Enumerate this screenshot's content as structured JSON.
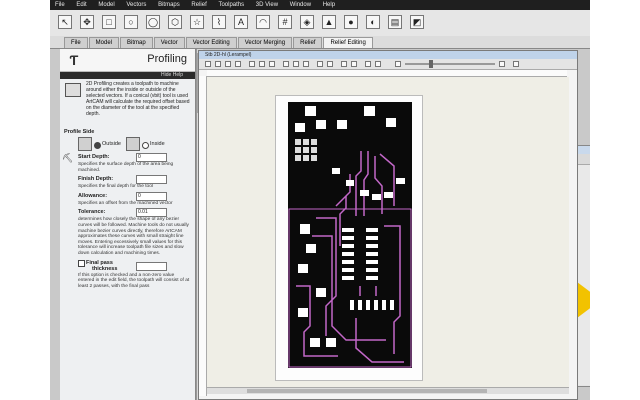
{
  "app": {
    "menu": [
      "File",
      "Edit",
      "Model",
      "Vectors",
      "Bitmaps",
      "Relief",
      "Toolpaths",
      "3D View",
      "Window",
      "Help"
    ]
  },
  "tabs": [
    {
      "label": "File",
      "active": false
    },
    {
      "label": "Model",
      "active": false
    },
    {
      "label": "Bitmap",
      "active": false
    },
    {
      "label": "Vector",
      "active": false
    },
    {
      "label": "Vector Editing",
      "active": false
    },
    {
      "label": "Vector Merging",
      "active": false
    },
    {
      "label": "Relief",
      "active": false
    },
    {
      "label": "Relief Editing",
      "active": true
    }
  ],
  "panel": {
    "title": "Profiling",
    "hide_help": "Hide Help",
    "description": "2D Profiling creates a toolpath to machine around either the inside or outside of the selected vectors. If a conical (vbit) tool is used ArtCAM will calculate the required offset based on the diameter of the tool at the specified depth.",
    "profile_side": {
      "title": "Profile Side",
      "outside": "Outside",
      "inside": "Inside",
      "selected": "outside"
    },
    "start_depth": {
      "label": "Start Depth:",
      "value": "0",
      "help": "Specifies the surface depth of the area being machined."
    },
    "finish_depth": {
      "label": "Finish Depth:",
      "value": "",
      "help": "Specifies the final depth for the tool"
    },
    "allowance": {
      "label": "Allowance:",
      "value": "0",
      "help": "Specifies an offset from the machined vector"
    },
    "tolerance": {
      "label": "Tolerance:",
      "value": "0.01",
      "help": "determines how closely the shape of any bezier curves will be followed. Machine tools do not usually machine bezier curves directly, therefore ArtCAM approximates these curves with small straight line moves. Entering excessively small values for this tolerance will increase toolpath file sizes and slow down calculation and machining times."
    },
    "final_pass": {
      "label": "Final pass",
      "label2": "thickness",
      "help": "If this option is checked and a non-zero value entered in the edit field, the toolpath will consist of at least 2 passes, with the final pass"
    }
  },
  "document": {
    "title": "Stb 2D-hl (Lerampel)"
  },
  "colors": {
    "trace": "#0a0a0a",
    "outline": "#c267c8",
    "background_window_accent": "#f2c200"
  }
}
